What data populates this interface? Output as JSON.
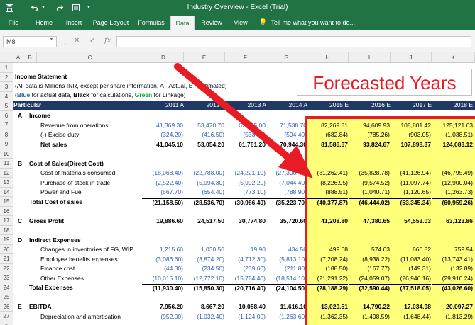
{
  "window": {
    "title": "Industry Overview - Excel (Trial)",
    "qat": {
      "save_icon": "save-icon",
      "undo_icon": "undo-icon",
      "redo_icon": "redo-icon",
      "customize_icon": "customize-icon",
      "window_icon": "window-icon"
    }
  },
  "ribbon": {
    "tabs": [
      "File",
      "Home",
      "Insert",
      "Page Layout",
      "Formulas",
      "Data",
      "Review",
      "View"
    ],
    "active_tab": "Data",
    "tell_me": "Tell me what you want to do..."
  },
  "formula_bar": {
    "name_box": "M8",
    "cancel": "✕",
    "enter": "✓",
    "fx": "fx",
    "content": ""
  },
  "columns": [
    "A",
    "B",
    "C",
    "D",
    "E",
    "F",
    "G",
    "H",
    "I",
    "J",
    "K"
  ],
  "rows": [
    "1",
    "2",
    "3",
    "4",
    "5",
    "6",
    "7",
    "8",
    "9",
    "10",
    "11",
    "12",
    "13",
    "14",
    "15",
    "16",
    "17",
    "18",
    "19",
    "20",
    "21",
    "22",
    "23",
    "24",
    "25",
    "26",
    "27",
    "28"
  ],
  "sheet": {
    "income_statement": "Income Statement",
    "note1": "(All data is Millions INR, except per share information, A - Actual, E - Estimated)",
    "note2_blue": "Blue",
    "note2_a": " for actual data, ",
    "note2_black": "Black",
    "note2_b": " for calculations, ",
    "note2_green": "Green",
    "note2_c": " for Linkage)",
    "header": {
      "particular": "Particular",
      "years": [
        "2011 A",
        "2012 A",
        "2013 A",
        "2014 A",
        "2015 E",
        "2016 E",
        "2017 E",
        "2018 E"
      ]
    },
    "annotation": "Forecasted Years",
    "lines": [
      {
        "row": "6",
        "letter": "A",
        "label": "Income",
        "bold": true,
        "values": []
      },
      {
        "row": "7",
        "letter": "",
        "label": "Revenue from operations",
        "indent": 2,
        "values": [
          "41,369.30",
          "53,470.70",
          "62,295.00",
          "71,538.70",
          "82,269.51",
          "94,609.93",
          "108,801.42",
          "125,121.63"
        ],
        "actual_blue": true
      },
      {
        "row": "8",
        "letter": "",
        "label": "(-) Excise duty",
        "indent": 2,
        "values": [
          "(324.20)",
          "(416.50)",
          "(533.80)",
          "(594.40)",
          "(682.84)",
          "(785.26)",
          "(903.05)",
          "(1,038.51)"
        ],
        "actual_blue": true
      },
      {
        "row": "9",
        "letter": "",
        "label": "Net sales",
        "indent": 2,
        "bold": true,
        "values": [
          "41,045.10",
          "53,054.20",
          "61,761.20",
          "70,944.30",
          "81,586.67",
          "93,824.67",
          "107,898.37",
          "124,083.12"
        ]
      },
      {
        "row": "10",
        "letter": "",
        "label": "",
        "values": []
      },
      {
        "row": "11",
        "letter": "B",
        "label": "Cost of Sales(Direct Cost)",
        "values": []
      },
      {
        "row": "12",
        "letter": "",
        "label": "Cost of materials consumed",
        "indent": 2,
        "values": [
          "(18,068.40)",
          "(22,788.00)",
          "(24,221.10)",
          "(27,390.40)",
          "(31,262.41)",
          "(35,828.78)",
          "(41,126.94)",
          "(46,795.49)"
        ],
        "actual_blue": true
      },
      {
        "row": "13",
        "letter": "",
        "label": "Purchase of stock in trade",
        "indent": 2,
        "values": [
          "(2,522.40)",
          "(5,094.30)",
          "(5,992.20)",
          "(7,044.40)",
          "(8,226.95)",
          "(9,574.52)",
          "(11,097.74)",
          "(12,900.04)"
        ],
        "actual_blue": true
      },
      {
        "row": "14",
        "letter": "",
        "label": "Power and Fuel",
        "indent": 2,
        "values": [
          "(567.70)",
          "(654.40)",
          "(773.10)",
          "(788.90)",
          "(888.51)",
          "(1,040.71)",
          "(1,120.65)",
          "(1,263.73)"
        ],
        "actual_blue": true
      },
      {
        "row": "15",
        "letter": "",
        "label": "Total Cost of sales",
        "indent": 1,
        "bold": true,
        "values": [
          "(21,158.50)",
          "(28,536.70)",
          "(30,986.40)",
          "(35,223.70)",
          "(40,377.87)",
          "(46,444.02)",
          "(53,345.34)",
          "(60,959.26)"
        ]
      },
      {
        "row": "16",
        "letter": "",
        "label": "",
        "values": []
      },
      {
        "row": "17",
        "letter": "C",
        "label": "Gross Profit",
        "bold": true,
        "values": [
          "19,886.60",
          "24,517.50",
          "30,774.80",
          "35,720.60",
          "41,208.80",
          "47,380.65",
          "54,553.03",
          "63,123.86"
        ]
      },
      {
        "row": "18",
        "letter": "",
        "label": "",
        "values": []
      },
      {
        "row": "19",
        "letter": "D",
        "label": "Indirect Expenses",
        "values": []
      },
      {
        "row": "20",
        "letter": "",
        "label": "Changes in inventories of FG, WIP",
        "indent": 2,
        "values": [
          "1,215.60",
          "1,030.50",
          "19.90",
          "434.50",
          "499.68",
          "574.63",
          "660.82",
          "759.94"
        ],
        "actual_blue": true
      },
      {
        "row": "21",
        "letter": "",
        "label": "Employee benefits expenses",
        "indent": 2,
        "values": [
          "(3,086.60)",
          "(3,874.20)",
          "(4,712.30)",
          "(5,813.10)",
          "(7,208.24)",
          "(8,938.22)",
          "(11,083.40)",
          "(13,743.41)"
        ],
        "actual_blue": true
      },
      {
        "row": "22",
        "letter": "",
        "label": "Finance cost",
        "indent": 2,
        "values": [
          "(44.30)",
          "(234.50)",
          "(239.60)",
          "(211.80)",
          "(188.50)",
          "(167.77)",
          "(149.31)",
          "(132.89)"
        ],
        "actual_blue": true
      },
      {
        "row": "23",
        "letter": "",
        "label": "Other Expenses",
        "indent": 2,
        "values": [
          "(10,015.10)",
          "(12,772.10)",
          "(15,784.40)",
          "(18,514.10)",
          "(21,291.22)",
          "(24,059.07)",
          "(26,946.16)",
          "(29,910.24)"
        ],
        "actual_blue": true
      },
      {
        "row": "24",
        "letter": "",
        "label": "Total Expenses",
        "indent": 1,
        "bold": true,
        "values": [
          "(11,930.40)",
          "(15,850.30)",
          "(20,716.40)",
          "(24,104.50)",
          "(28,188.29)",
          "(32,590.44)",
          "(37,518.05)",
          "(43,026.60)"
        ]
      },
      {
        "row": "25",
        "letter": "",
        "label": "",
        "values": []
      },
      {
        "row": "26",
        "letter": "E",
        "label": "EBITDA",
        "bold": true,
        "values": [
          "7,956.20",
          "8,667.20",
          "10,058.40",
          "11,616.10",
          "13,020.51",
          "14,790.22",
          "17,034.98",
          "20,097.27"
        ]
      },
      {
        "row": "27",
        "letter": "",
        "label": "Depreciation and amortisation",
        "indent": 2,
        "values": [
          "(952.00)",
          "(1,032.40)",
          "(1,124.00)",
          "(1,263.60)",
          "(1,362.35)",
          "(1,498.59)",
          "(1,648.44)",
          "(1,813.29)"
        ],
        "actual_blue": true
      }
    ]
  },
  "arrow": {
    "color": "#e81c24"
  }
}
